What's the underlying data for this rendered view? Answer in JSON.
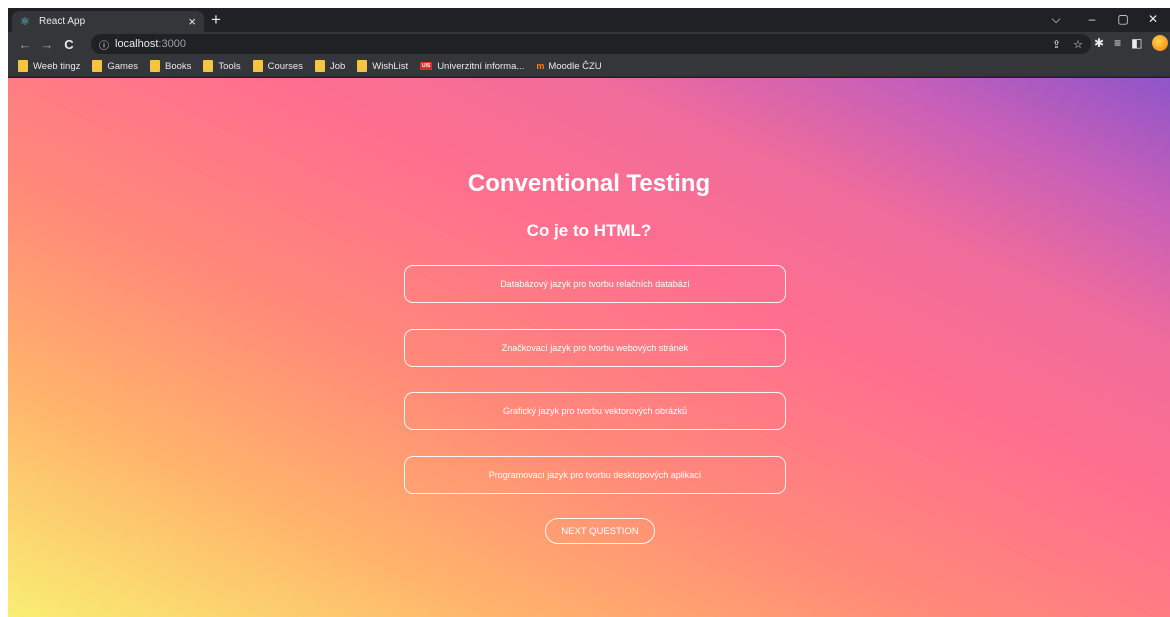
{
  "browser": {
    "tab": {
      "title": "React App",
      "favicon": "⚛",
      "close": "×"
    },
    "new_tab": "+",
    "window_controls": {
      "dropdown": "⌵",
      "minimize": "–",
      "restore": "▢",
      "close": "✕"
    },
    "nav": {
      "back": "←",
      "forward": "→",
      "reload": "C"
    },
    "address": {
      "info_icon": "ⓘ",
      "host": "localhost",
      "port": ":3000"
    },
    "omnibox_icons": {
      "share": "⇪",
      "star": "☆"
    },
    "extension_icons": {
      "puzzle": "✱",
      "reading_list": "≡",
      "side_panel": "◧",
      "menu": "⋮"
    },
    "bookmarks": [
      {
        "label": "Weeb tingz",
        "icon": "folder-icon"
      },
      {
        "label": "Games",
        "icon": "folder-icon"
      },
      {
        "label": "Books",
        "icon": "folder-icon"
      },
      {
        "label": "Tools",
        "icon": "folder-icon"
      },
      {
        "label": "Courses",
        "icon": "folder-icon"
      },
      {
        "label": "Job",
        "icon": "folder-icon"
      },
      {
        "label": "WishList",
        "icon": "folder-icon"
      },
      {
        "label": "Univerzitní informa...",
        "icon": "uis-icon",
        "icon_text": "UIS"
      },
      {
        "label": "Moodle ČZU",
        "icon": "moodle-icon",
        "icon_text": "m"
      }
    ]
  },
  "page": {
    "title": "Conventional Testing",
    "question": "Co je to HTML?",
    "answers": [
      "Databázový jazyk pro tvorbu relačních databází",
      "Značkovací jazyk pro tvorbu webových stránek",
      "Grafický jazyk pro tvorbu vektorových obrázků",
      "Programovací jazyk pro tvorbu desktopových aplikací"
    ],
    "next_button": "NEXT QUESTION"
  },
  "colors": {
    "gradient_start": "#f9ee72",
    "gradient_mid": "#ff6f8e",
    "gradient_end": "#8f55c9",
    "text": "#ffffff"
  }
}
